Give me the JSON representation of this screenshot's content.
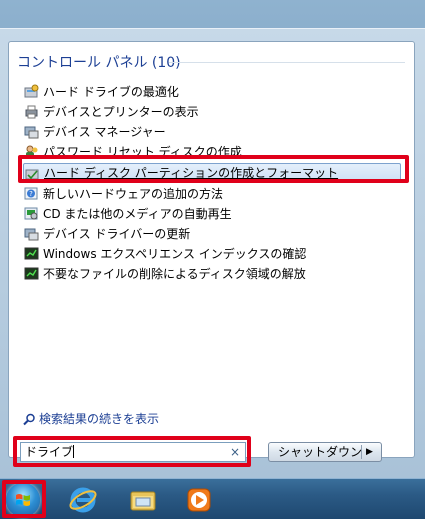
{
  "category": {
    "title": "コントロール パネル (10)"
  },
  "results": [
    {
      "label": "ハード ドライブの最適化",
      "icon": "defrag-icon"
    },
    {
      "label": "デバイスとプリンターの表示",
      "icon": "printer-icon"
    },
    {
      "label": "デバイス マネージャー",
      "icon": "device-manager-icon"
    },
    {
      "label": "パスワード リセット ディスクの作成",
      "icon": "user-icon"
    },
    {
      "label": "ハード ディスク パーティションの作成とフォーマット",
      "icon": "disk-management-icon",
      "selected": true
    },
    {
      "label": "新しいハードウェアの追加の方法",
      "icon": "help-icon"
    },
    {
      "label": "CD または他のメディアの自動再生",
      "icon": "autoplay-icon"
    },
    {
      "label": "デバイス ドライバーの更新",
      "icon": "device-driver-icon"
    },
    {
      "label": "Windows エクスペリエンス インデックスの確認",
      "icon": "performance-icon"
    },
    {
      "label": "不要なファイルの削除によるディスク領域の解放",
      "icon": "performance-icon"
    }
  ],
  "see_more": "検索結果の続きを表示",
  "search": {
    "value": "ドライブ",
    "clear_symbol": "×"
  },
  "shutdown": {
    "label": "シャットダウン",
    "arrow": "▶"
  },
  "taskbar": {
    "items": [
      "start-orb",
      "internet-explorer",
      "windows-explorer",
      "windows-media-player"
    ]
  },
  "colors": {
    "highlight": "#e0001a",
    "heading": "#1c3f94"
  }
}
